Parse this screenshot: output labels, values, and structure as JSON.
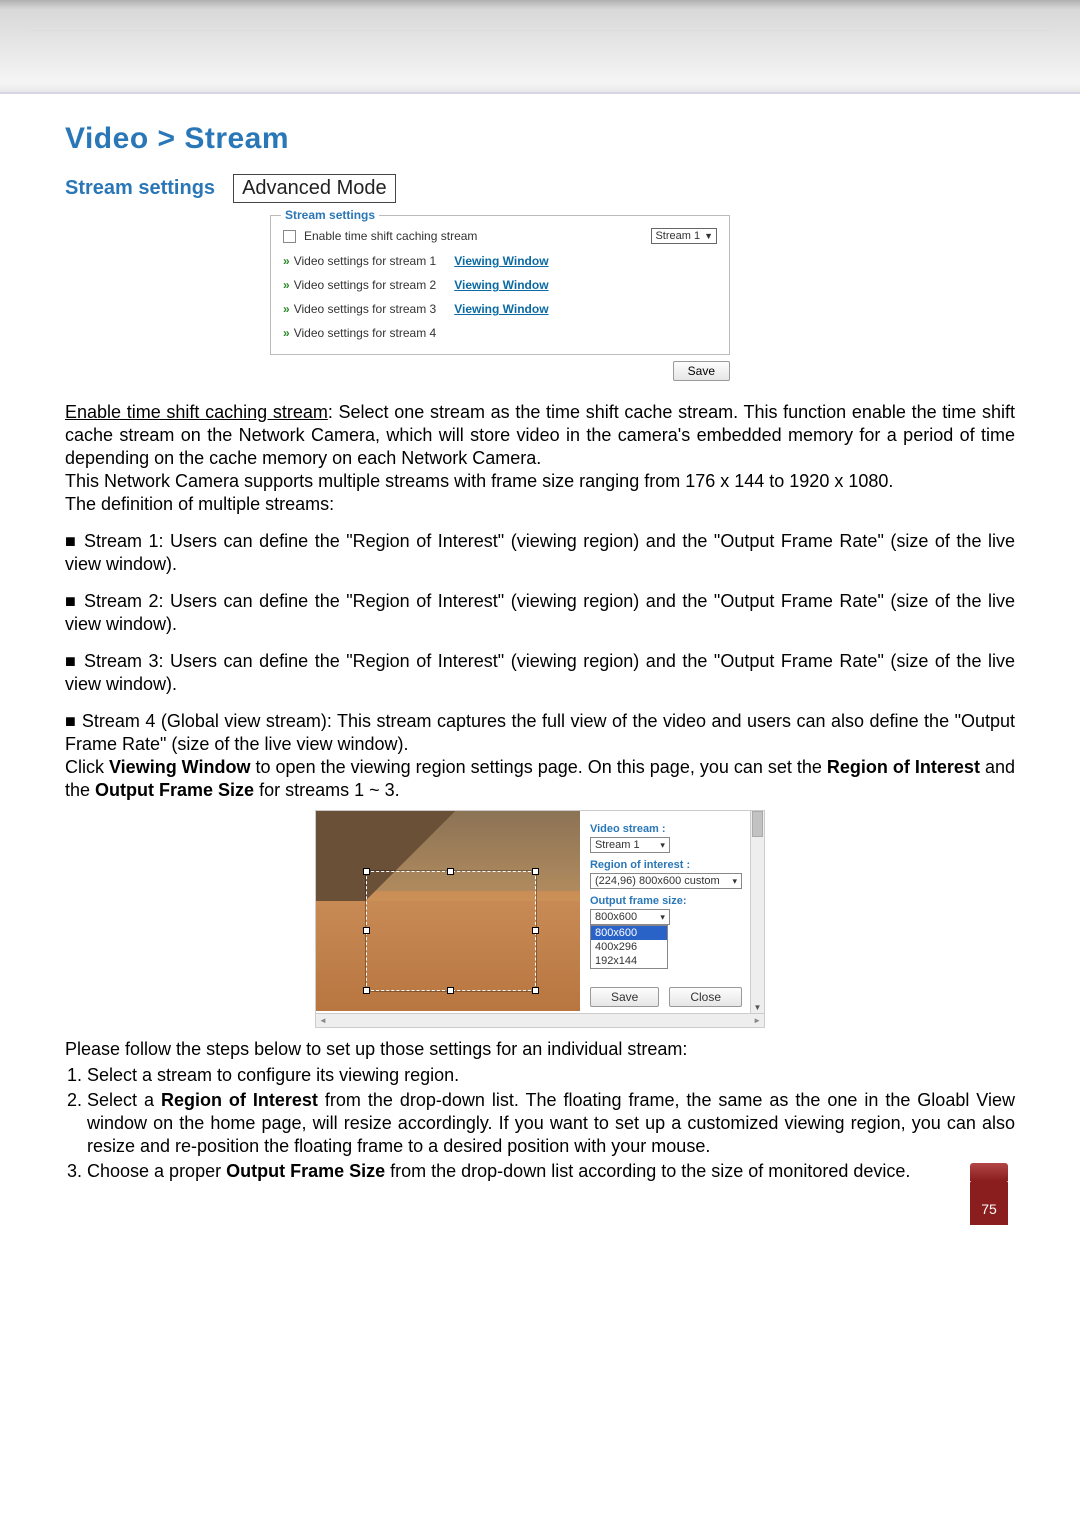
{
  "header": {
    "title": "Video > Stream",
    "sub": "Stream settings",
    "advanced": "Advanced Mode"
  },
  "shot1": {
    "legend": "Stream settings",
    "enable_label": "Enable time shift caching stream",
    "stream_select": "Stream 1",
    "rows": [
      {
        "label": "Video settings for stream 1",
        "link": "Viewing Window"
      },
      {
        "label": "Video settings for stream 2",
        "link": "Viewing Window"
      },
      {
        "label": "Video settings for stream 3",
        "link": "Viewing Window"
      },
      {
        "label": "Video settings for stream 4",
        "link": ""
      }
    ],
    "save": "Save"
  },
  "para1": {
    "underline": "Enable time shift caching stream",
    "rest": ": Select one stream as the time shift cache stream. This function enable the time shift cache stream on the Network Camera, which will store video in the camera's embedded memory for a period of time depending on the cache memory on each Network Camera.",
    "line2": "This Network Camera supports multiple streams with frame size ranging from 176 x 144 to 1920 x 1080."
  },
  "streams_intro": "The definition of multiple streams:",
  "streams": [
    "Stream 1: Users can define the \"Region of Interest\" (viewing region) and the \"Output Frame Rate\" (size of the live view window).",
    "Stream 2: Users can define the \"Region of Interest\" (viewing region) and the \"Output Frame Rate\" (size of the live view window).",
    "Stream 3: Users can define the \"Region of Interest\" (viewing region) and the \"Output Frame Rate\" (size of the live view window).",
    "Stream 4 (Global view stream): This stream captures the full view of the video and users can also define the \"Output Frame Rate\" (size of the live view window)."
  ],
  "viewing_para": {
    "pre": "Click ",
    "bold1": "Viewing Window",
    "mid": " to open the viewing region settings page. On this page, you can set the ",
    "bold2": "Region of Interest",
    "and": " and the ",
    "bold3": "Output Frame Size",
    "post": " for streams 1 ~ 3."
  },
  "shot2": {
    "video_stream_label": "Video stream :",
    "video_stream_value": "Stream 1",
    "roi_label": "Region of interest :",
    "roi_value": "(224,96) 800x600 custom",
    "ofs_label": "Output frame size:",
    "ofs_value": "800x600",
    "ofs_options": [
      "800x600",
      "400x296",
      "192x144"
    ],
    "save": "Save",
    "close": "Close"
  },
  "steps_intro": "Please follow the steps below to set up those settings for an individual stream:",
  "steps": {
    "s1": "Select a stream to configure its viewing region.",
    "s2_pre": "Select a ",
    "s2_b": "Region of Interest",
    "s2_post": " from the drop-down list. The floating frame, the same as the one in the Gloabl View window on the home page, will resize accordingly. If you want to set up a customized viewing region, you can also resize and re-position the floating frame to a desired position with your mouse.",
    "s3_pre": "Choose a proper ",
    "s3_b": "Output Frame Size",
    "s3_post": " from the drop-down list according to the size of monitored device."
  },
  "page_number": "75"
}
